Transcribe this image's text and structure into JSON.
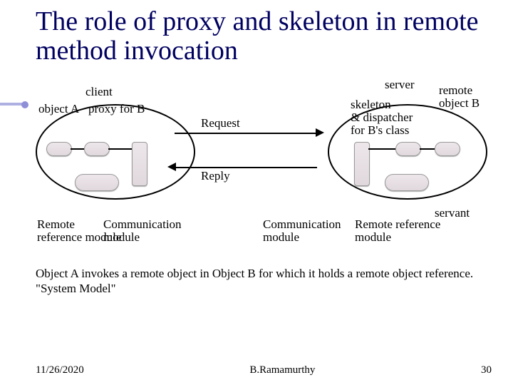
{
  "title": "The role of proxy and skeleton in remote method invocation",
  "diagram": {
    "client_label": "client",
    "server_label": "server",
    "objectA_label": "object A",
    "proxy_label": "proxy for B",
    "skeleton_label": "skeleton\n& dispatcher\nfor B's class",
    "remote_objectB_label": "remote\nobject B",
    "request_label": "Request",
    "reply_label": "Reply",
    "client_rrm_label": "Remote\nreference module",
    "client_cm_label": "Communication\nmodule",
    "server_cm_label": "Communication\nmodule",
    "server_rrm_label": "Remote reference\nmodule",
    "servant_label": "servant"
  },
  "caption": "Object A invokes a remote object in Object B for which it holds a remote object reference.\n\"System Model\"",
  "footer": {
    "date": "11/26/2020",
    "author": "B.Ramamurthy",
    "page": "30"
  },
  "chart_data": {
    "type": "diagram",
    "title": "The role of proxy and skeleton in remote method invocation",
    "nodes": [
      {
        "id": "client",
        "label": "client",
        "contains": [
          "objectA",
          "proxyForB",
          "clientCommModule",
          "clientRRM"
        ]
      },
      {
        "id": "server",
        "label": "server",
        "contains": [
          "skeletonDispatcher",
          "remoteObjectB",
          "serverCommModule",
          "serverRRM",
          "servant"
        ]
      },
      {
        "id": "objectA",
        "label": "object A"
      },
      {
        "id": "proxyForB",
        "label": "proxy for B"
      },
      {
        "id": "clientCommModule",
        "label": "Communication module"
      },
      {
        "id": "clientRRM",
        "label": "Remote reference module"
      },
      {
        "id": "serverCommModule",
        "label": "Communication module"
      },
      {
        "id": "serverRRM",
        "label": "Remote reference module"
      },
      {
        "id": "skeletonDispatcher",
        "label": "skeleton & dispatcher for B's class"
      },
      {
        "id": "remoteObjectB",
        "label": "remote object B"
      },
      {
        "id": "servant",
        "label": "servant"
      }
    ],
    "edges": [
      {
        "from": "objectA",
        "to": "proxyForB",
        "label": ""
      },
      {
        "from": "proxyForB",
        "to": "clientCommModule",
        "label": ""
      },
      {
        "from": "clientCommModule",
        "to": "serverCommModule",
        "label": "Request",
        "direction": "forward"
      },
      {
        "from": "serverCommModule",
        "to": "clientCommModule",
        "label": "Reply",
        "direction": "forward"
      },
      {
        "from": "serverCommModule",
        "to": "skeletonDispatcher",
        "label": ""
      },
      {
        "from": "skeletonDispatcher",
        "to": "remoteObjectB",
        "label": ""
      }
    ],
    "annotations": [
      "Object A invokes a remote object in Object B for which it holds a remote object reference.",
      "\"System Model\""
    ]
  }
}
